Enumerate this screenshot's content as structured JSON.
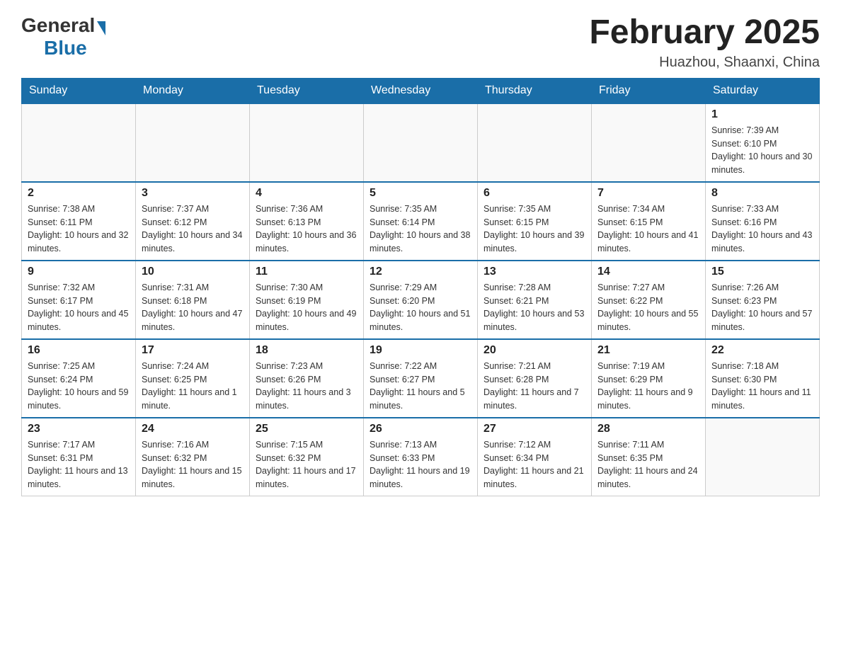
{
  "logo": {
    "general": "General",
    "blue": "Blue",
    "triangle": "▶"
  },
  "title": "February 2025",
  "location": "Huazhou, Shaanxi, China",
  "days_of_week": [
    "Sunday",
    "Monday",
    "Tuesday",
    "Wednesday",
    "Thursday",
    "Friday",
    "Saturday"
  ],
  "weeks": [
    {
      "days": [
        {
          "number": "",
          "info": ""
        },
        {
          "number": "",
          "info": ""
        },
        {
          "number": "",
          "info": ""
        },
        {
          "number": "",
          "info": ""
        },
        {
          "number": "",
          "info": ""
        },
        {
          "number": "",
          "info": ""
        },
        {
          "number": "1",
          "info": "Sunrise: 7:39 AM\nSunset: 6:10 PM\nDaylight: 10 hours and 30 minutes."
        }
      ]
    },
    {
      "days": [
        {
          "number": "2",
          "info": "Sunrise: 7:38 AM\nSunset: 6:11 PM\nDaylight: 10 hours and 32 minutes."
        },
        {
          "number": "3",
          "info": "Sunrise: 7:37 AM\nSunset: 6:12 PM\nDaylight: 10 hours and 34 minutes."
        },
        {
          "number": "4",
          "info": "Sunrise: 7:36 AM\nSunset: 6:13 PM\nDaylight: 10 hours and 36 minutes."
        },
        {
          "number": "5",
          "info": "Sunrise: 7:35 AM\nSunset: 6:14 PM\nDaylight: 10 hours and 38 minutes."
        },
        {
          "number": "6",
          "info": "Sunrise: 7:35 AM\nSunset: 6:15 PM\nDaylight: 10 hours and 39 minutes."
        },
        {
          "number": "7",
          "info": "Sunrise: 7:34 AM\nSunset: 6:15 PM\nDaylight: 10 hours and 41 minutes."
        },
        {
          "number": "8",
          "info": "Sunrise: 7:33 AM\nSunset: 6:16 PM\nDaylight: 10 hours and 43 minutes."
        }
      ]
    },
    {
      "days": [
        {
          "number": "9",
          "info": "Sunrise: 7:32 AM\nSunset: 6:17 PM\nDaylight: 10 hours and 45 minutes."
        },
        {
          "number": "10",
          "info": "Sunrise: 7:31 AM\nSunset: 6:18 PM\nDaylight: 10 hours and 47 minutes."
        },
        {
          "number": "11",
          "info": "Sunrise: 7:30 AM\nSunset: 6:19 PM\nDaylight: 10 hours and 49 minutes."
        },
        {
          "number": "12",
          "info": "Sunrise: 7:29 AM\nSunset: 6:20 PM\nDaylight: 10 hours and 51 minutes."
        },
        {
          "number": "13",
          "info": "Sunrise: 7:28 AM\nSunset: 6:21 PM\nDaylight: 10 hours and 53 minutes."
        },
        {
          "number": "14",
          "info": "Sunrise: 7:27 AM\nSunset: 6:22 PM\nDaylight: 10 hours and 55 minutes."
        },
        {
          "number": "15",
          "info": "Sunrise: 7:26 AM\nSunset: 6:23 PM\nDaylight: 10 hours and 57 minutes."
        }
      ]
    },
    {
      "days": [
        {
          "number": "16",
          "info": "Sunrise: 7:25 AM\nSunset: 6:24 PM\nDaylight: 10 hours and 59 minutes."
        },
        {
          "number": "17",
          "info": "Sunrise: 7:24 AM\nSunset: 6:25 PM\nDaylight: 11 hours and 1 minute."
        },
        {
          "number": "18",
          "info": "Sunrise: 7:23 AM\nSunset: 6:26 PM\nDaylight: 11 hours and 3 minutes."
        },
        {
          "number": "19",
          "info": "Sunrise: 7:22 AM\nSunset: 6:27 PM\nDaylight: 11 hours and 5 minutes."
        },
        {
          "number": "20",
          "info": "Sunrise: 7:21 AM\nSunset: 6:28 PM\nDaylight: 11 hours and 7 minutes."
        },
        {
          "number": "21",
          "info": "Sunrise: 7:19 AM\nSunset: 6:29 PM\nDaylight: 11 hours and 9 minutes."
        },
        {
          "number": "22",
          "info": "Sunrise: 7:18 AM\nSunset: 6:30 PM\nDaylight: 11 hours and 11 minutes."
        }
      ]
    },
    {
      "days": [
        {
          "number": "23",
          "info": "Sunrise: 7:17 AM\nSunset: 6:31 PM\nDaylight: 11 hours and 13 minutes."
        },
        {
          "number": "24",
          "info": "Sunrise: 7:16 AM\nSunset: 6:32 PM\nDaylight: 11 hours and 15 minutes."
        },
        {
          "number": "25",
          "info": "Sunrise: 7:15 AM\nSunset: 6:32 PM\nDaylight: 11 hours and 17 minutes."
        },
        {
          "number": "26",
          "info": "Sunrise: 7:13 AM\nSunset: 6:33 PM\nDaylight: 11 hours and 19 minutes."
        },
        {
          "number": "27",
          "info": "Sunrise: 7:12 AM\nSunset: 6:34 PM\nDaylight: 11 hours and 21 minutes."
        },
        {
          "number": "28",
          "info": "Sunrise: 7:11 AM\nSunset: 6:35 PM\nDaylight: 11 hours and 24 minutes."
        },
        {
          "number": "",
          "info": ""
        }
      ]
    }
  ]
}
